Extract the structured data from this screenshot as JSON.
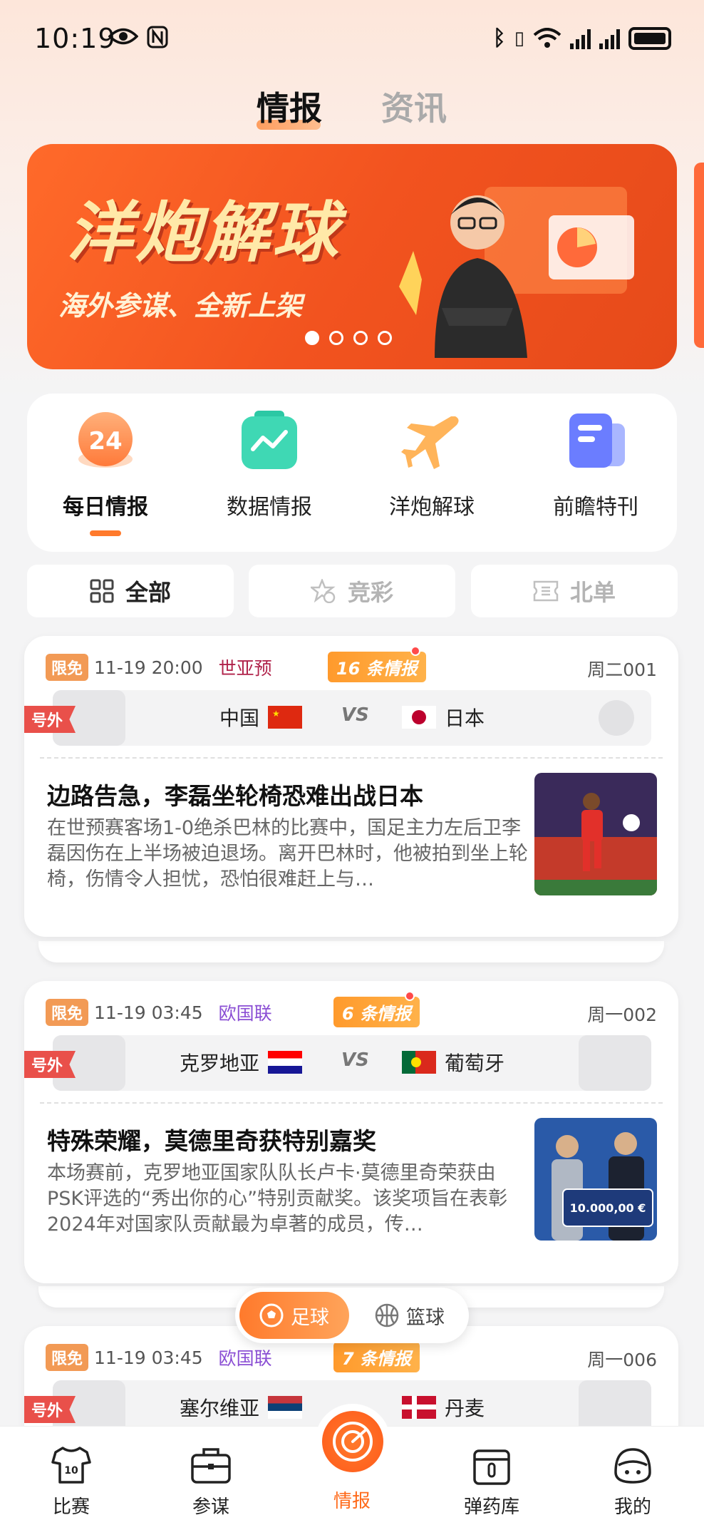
{
  "status_bar": {
    "time": "10:19"
  },
  "top_tabs": {
    "active": "情报",
    "inactive": "资讯"
  },
  "banner": {
    "title": "洋炮解球",
    "subtitle": "海外参谋、全新上架"
  },
  "quick_menu": [
    {
      "label": "每日情报",
      "icon": "daily-24-icon",
      "badge": "24"
    },
    {
      "label": "数据情报",
      "icon": "data-chart-icon"
    },
    {
      "label": "洋炮解球",
      "icon": "plane-icon"
    },
    {
      "label": "前瞻特刊",
      "icon": "magazine-icon"
    }
  ],
  "filters": [
    {
      "label": "全部",
      "icon": "grid-icon"
    },
    {
      "label": "竞彩",
      "icon": "star-lottery-icon"
    },
    {
      "label": "北单",
      "icon": "ticket-icon"
    }
  ],
  "cards": [
    {
      "free": "限免",
      "time": "11-19 20:00",
      "league": "世亚预",
      "league_color": "#b0224a",
      "info": "16 条情报",
      "code": "周二001",
      "tag": "号外",
      "home": "中国",
      "vs": "VS",
      "away": "日本",
      "headline": "边路告急，李磊坐轮椅恐难出战日本",
      "summary": "在世预赛客场1-0绝杀巴林的比赛中，国足主力左后卫李磊因伤在上半场被迫退场。离开巴林时，他被拍到坐上轮椅，伤情令人担忧，恐怕很难赶上与…"
    },
    {
      "free": "限免",
      "time": "11-19 03:45",
      "league": "欧国联",
      "league_color": "#8b4fd4",
      "info": "6 条情报",
      "code": "周一002",
      "tag": "号外",
      "home": "克罗地亚",
      "vs": "VS",
      "away": "葡萄牙",
      "headline": "特殊荣耀，莫德里奇获特别嘉奖",
      "summary": "本场赛前，克罗地亚国家队队长卢卡·莫德里奇荣获由PSK评选的“秀出你的心”特别贡献奖。该奖项旨在表彰2024年对国家队贡献最为卓著的成员，传…",
      "thumb_text": "10.000,00 €"
    },
    {
      "free": "限免",
      "time": "11-19 03:45",
      "league": "欧国联",
      "league_color": "#8b4fd4",
      "info": "7 条情报",
      "code": "周一006",
      "tag": "号外",
      "home": "塞尔维亚",
      "away": "丹麦"
    }
  ],
  "sport_toggle": {
    "football": "足球",
    "basketball": "篮球"
  },
  "bottom_nav": [
    {
      "label": "比赛",
      "icon": "jersey-icon"
    },
    {
      "label": "参谋",
      "icon": "briefcase-icon"
    },
    {
      "label": "情报",
      "icon": "radar-icon"
    },
    {
      "label": "弹药库",
      "icon": "ammo-box-icon"
    },
    {
      "label": "我的",
      "icon": "profile-icon"
    }
  ],
  "colors": {
    "accent": "#ff7a2c",
    "badge_red": "#e9504a",
    "banner": "#f2531f"
  }
}
